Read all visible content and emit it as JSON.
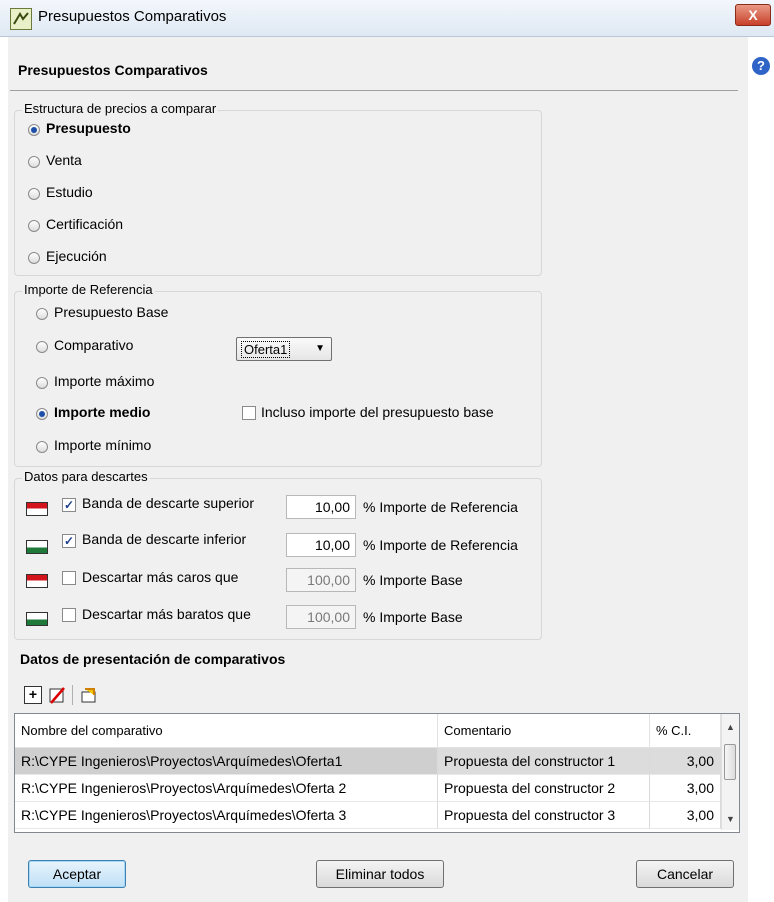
{
  "window": {
    "title": "Presupuestos Comparativos",
    "close_label": "X"
  },
  "dialog": {
    "heading": "Presupuestos Comparativos",
    "help_label": "?"
  },
  "estructura": {
    "legend": "Estructura de precios a comparar",
    "options": [
      {
        "label": "Presupuesto",
        "selected": true
      },
      {
        "label": "Venta",
        "selected": false
      },
      {
        "label": "Estudio",
        "selected": false
      },
      {
        "label": "Certificación",
        "selected": false
      },
      {
        "label": "Ejecución",
        "selected": false
      }
    ]
  },
  "importe": {
    "legend": "Importe de Referencia",
    "options": [
      {
        "label": "Presupuesto Base",
        "selected": false
      },
      {
        "label": "Comparativo",
        "selected": false
      },
      {
        "label": "Importe máximo",
        "selected": false
      },
      {
        "label": "Importe medio",
        "selected": true
      },
      {
        "label": "Importe mínimo",
        "selected": false
      }
    ],
    "combo_value": "Oferta1",
    "incluso_label": "Incluso importe del presupuesto base",
    "incluso_checked": false
  },
  "descartes": {
    "legend": "Datos para descartes",
    "rows": [
      {
        "label": "Banda de descarte superior",
        "checked": true,
        "value": "10,00",
        "unit": "% Importe de Referencia",
        "band": "red"
      },
      {
        "label": "Banda de descarte inferior",
        "checked": true,
        "value": "10,00",
        "unit": "% Importe de Referencia",
        "band": "green"
      },
      {
        "label": "Descartar más caros que",
        "checked": false,
        "value": "100,00",
        "unit": "% Importe Base",
        "band": "red"
      },
      {
        "label": "Descartar más baratos que",
        "checked": false,
        "value": "100,00",
        "unit": "% Importe Base",
        "band": "green"
      }
    ]
  },
  "presentacion": {
    "heading": "Datos de presentación de comparativos",
    "toolbar": [
      {
        "icon": "add-row-icon"
      },
      {
        "icon": "delete-row-icon"
      },
      {
        "icon": "edit-row-icon"
      }
    ],
    "columns": [
      "Nombre del comparativo",
      "Comentario",
      "% C.I."
    ],
    "rows": [
      {
        "name": "R:\\CYPE Ingenieros\\Proyectos\\Arquímedes\\Oferta1",
        "comment": "Propuesta del constructor 1",
        "ci": "3,00"
      },
      {
        "name": "R:\\CYPE Ingenieros\\Proyectos\\Arquímedes\\Oferta 2",
        "comment": "Propuesta del constructor 2",
        "ci": "3,00"
      },
      {
        "name": "R:\\CYPE Ingenieros\\Proyectos\\Arquímedes\\Oferta 3",
        "comment": "Propuesta del constructor 3",
        "ci": "3,00"
      }
    ]
  },
  "buttons": {
    "accept": "Aceptar",
    "delete_all": "Eliminar todos",
    "cancel": "Cancelar"
  }
}
